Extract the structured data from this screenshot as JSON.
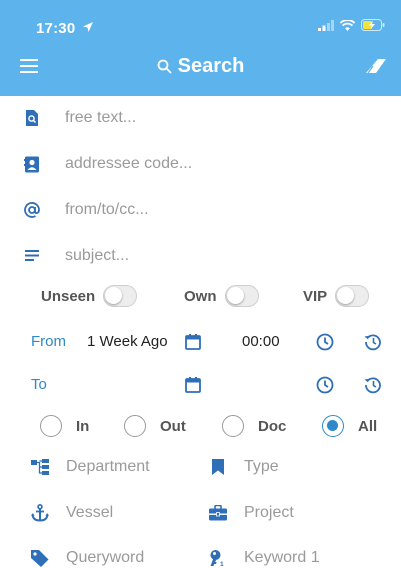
{
  "status_bar": {
    "time": "17:30"
  },
  "nav": {
    "title": "Search"
  },
  "fields": [
    {
      "name": "free-text-field",
      "icon": "search-document-icon",
      "placeholder": "free text..."
    },
    {
      "name": "addressee-code-field",
      "icon": "contact-card-icon",
      "placeholder": "addressee code..."
    },
    {
      "name": "from-to-cc-field",
      "icon": "at-sign-icon",
      "placeholder": "from/to/cc..."
    },
    {
      "name": "subject-field",
      "icon": "lines-icon",
      "placeholder": "subject..."
    }
  ],
  "toggles": {
    "unseen": {
      "label": "Unseen",
      "on": false
    },
    "own": {
      "label": "Own",
      "on": false
    },
    "vip": {
      "label": "VIP",
      "on": false
    }
  },
  "from": {
    "label": "From",
    "date": "1 Week Ago",
    "time": "00:00"
  },
  "to": {
    "label": "To",
    "date": "",
    "time": ""
  },
  "direction": {
    "options": [
      "In",
      "Out",
      "Doc",
      "All"
    ],
    "selected": "All"
  },
  "filters": {
    "department": "Department",
    "type": "Type",
    "vessel": "Vessel",
    "project": "Project",
    "queryword": "Queryword",
    "keyword1": "Keyword 1"
  },
  "colors": {
    "header": "#5db3ec",
    "accent": "#2f89c9",
    "icon": "#2f6fb8",
    "placeholder": "#9a9a9a"
  }
}
